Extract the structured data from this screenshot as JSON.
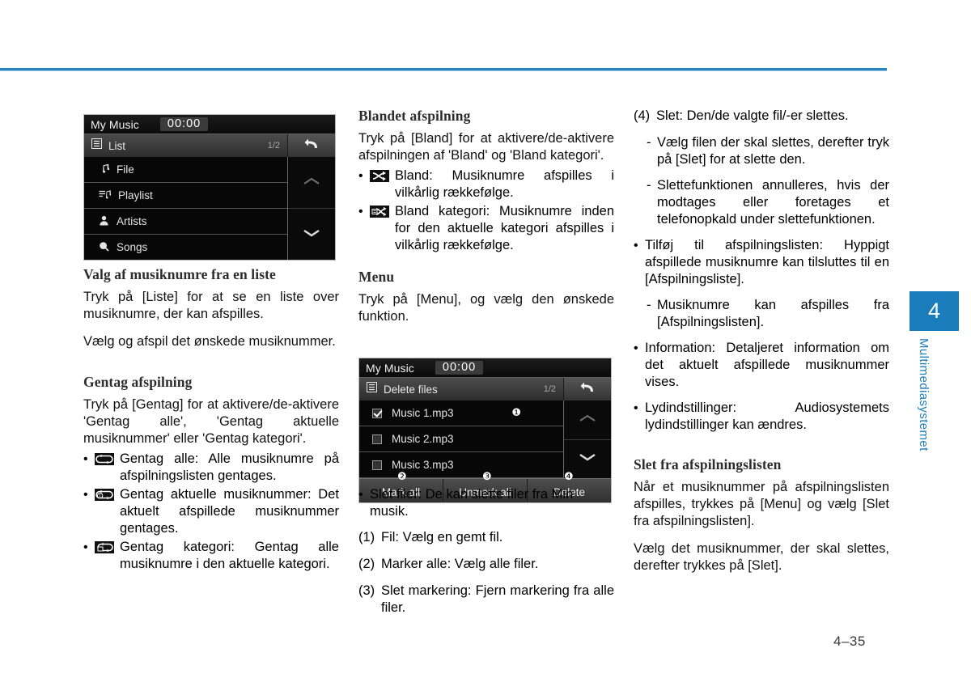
{
  "page": {
    "number": "4–35",
    "chapter_tab": {
      "number": "4",
      "label": "Multimediasystemet",
      "color": "#1a7cba"
    }
  },
  "screens": {
    "list": {
      "title": "My Music",
      "clock": "00:00",
      "header_label": "List",
      "page_indicator": "1/2",
      "back_icon": "back-arrow-icon",
      "header_icon": "list-icon",
      "rows": [
        {
          "label": "File",
          "icon": "music-note-icon"
        },
        {
          "label": "Playlist",
          "icon": "playlist-icon"
        },
        {
          "label": "Artists",
          "icon": "person-icon"
        },
        {
          "label": "Songs",
          "icon": "song-search-icon"
        }
      ],
      "scroll_up_icon": "chevron-up-icon",
      "scroll_down_icon": "chevron-down-icon"
    },
    "delete": {
      "title": "My Music",
      "clock": "00:00",
      "header_label": "Delete files",
      "page_indicator": "1/2",
      "back_icon": "back-arrow-icon",
      "header_icon": "list-icon",
      "rows": [
        {
          "label": "Music 1.mp3",
          "checked": true,
          "callout": "❶"
        },
        {
          "label": "Music 2.mp3",
          "checked": false,
          "callout": ""
        },
        {
          "label": "Music 3.mp3",
          "checked": false,
          "callout": ""
        }
      ],
      "buttons": [
        {
          "label": "Mark all",
          "callout": "❷"
        },
        {
          "label": "Unmark all",
          "callout": "❸"
        },
        {
          "label": "Delete",
          "callout": "❹"
        }
      ],
      "scroll_up_icon": "chevron-up-icon",
      "scroll_down_icon": "chevron-down-icon"
    }
  },
  "column1": {
    "heading_list": "Valg af musiknumre fra en liste",
    "p_list_1": "Tryk på [Liste] for at se en liste over musiknumre, der kan afspilles.",
    "p_list_2": "Vælg og afspil det ønskede musiknummer.",
    "heading_repeat": "Gentag afspilning",
    "p_repeat_1": "Tryk på [Gentag] for at aktivere/de-aktivere 'Gentag alle', 'Gentag aktuelle musiknummer' eller 'Gentag kategori'.",
    "bullets": [
      {
        "icon": "repeat-all-icon",
        "text": "Gentag alle: Alle musiknumre på afspilningslisten gentages."
      },
      {
        "icon": "repeat-one-icon",
        "text": "Gentag aktuelle musiknummer: Det aktuelt afspillede musiknummer gentages."
      },
      {
        "icon": "repeat-category-icon",
        "text": "Gentag kategori: Gentag alle musiknumre i den aktuelle kategori."
      }
    ]
  },
  "column2": {
    "heading_shuffle": "Blandet afspilning",
    "p_shuffle_1": "Tryk på [Bland] for at aktivere/de-aktivere afspilningen af 'Bland' og 'Bland kategori'.",
    "bullets": [
      {
        "icon": "shuffle-icon",
        "text": "Bland: Musiknumre afspilles i vilkårlig rækkefølge."
      },
      {
        "icon": "shuffle-category-icon",
        "text": "Bland kategori: Musiknumre inden for den aktuelle kategori afspilles i vilkårlig rækkefølge."
      }
    ],
    "heading_menu": "Menu",
    "p_menu_1": "Tryk på [Menu], og vælg den ønskede funktion.",
    "bullet_delete": "Slet filer: De kan slette filer fra Min musik.",
    "numbered": [
      {
        "num": "(1)",
        "text": "Fil: Vælg en gemt fil."
      },
      {
        "num": "(2)",
        "text": "Marker alle: Vælg alle filer."
      },
      {
        "num": "(3)",
        "text": "Slet markering: Fjern markering fra alle filer."
      }
    ]
  },
  "column3": {
    "item4_num": "(4)",
    "item4_text": "Slet: Den/de valgte fil/-er slettes.",
    "dashes_a": [
      "Vælg filen der skal slettes, derefter tryk på [Slet] for at slette den.",
      "Slettefunktionen annulleres, hvis der modtages eller foretages et telefonopkald under slettefunktionen."
    ],
    "bullet_add": "Tilføj til afspilningslisten: Hyppigt afspillede musiknumre kan tilsluttes til en [Afspilningsliste].",
    "dash_add": "Musiknumre kan afspilles fra [Afspilningslisten].",
    "bullet_info": "Information: Detaljeret information om det aktuelt afspillede musiknummer vises.",
    "bullet_sound": "Lydindstillinger: Audiosystemets lydindstillinger kan ændres.",
    "heading_delete_pl": "Slet fra afspilningslisten",
    "p_delete_1": "Når et musiknummer på afspilningslisten afspilles, trykkes på [Menu] og vælg [Slet fra afspilningslisten].",
    "p_delete_2": "Vælg det musiknummer, der skal slettes, derefter trykkes på [Slet]."
  }
}
